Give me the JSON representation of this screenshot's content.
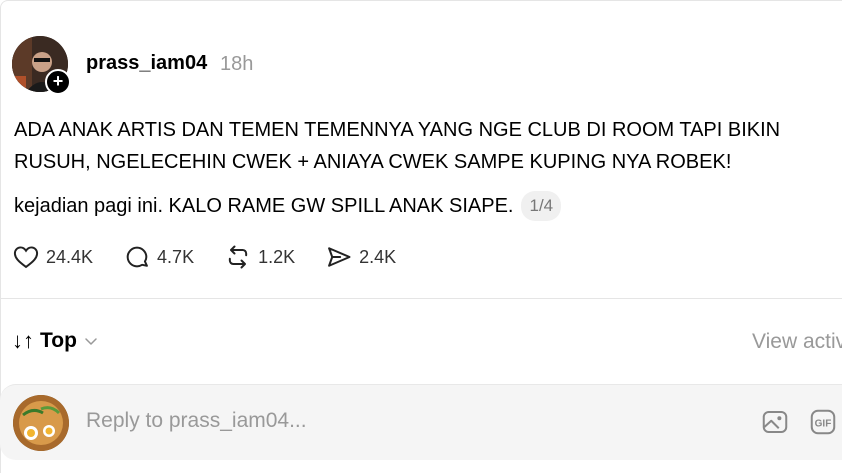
{
  "post": {
    "username": "prass_iam04",
    "time": "18h",
    "text_line1": "ADA ANAK ARTIS DAN TEMEN TEMENNYA YANG NGE CLUB DI ROOM TAPI BIKIN",
    "text_line2": "RUSUH, NGELECEHIN CWEK + ANIAYA CWEK SAMPE KUPING NYA ROBEK!",
    "text_line3": "kejadian pagi ini. KALO RAME GW SPILL ANAK SIAPE.",
    "page_indicator": "1/4"
  },
  "actions": {
    "likes": "24.4K",
    "comments": "4.7K",
    "reposts": "1.2K",
    "shares": "2.4K"
  },
  "sort": {
    "label": "Top",
    "arrows": "↓↑"
  },
  "view_activity": "View activ",
  "reply": {
    "placeholder": "Reply to prass_iam04..."
  },
  "icons": [
    "plus-icon",
    "heart-icon",
    "comment-icon",
    "repost-icon",
    "share-icon",
    "chevron-down-icon",
    "image-icon",
    "gif-icon"
  ]
}
